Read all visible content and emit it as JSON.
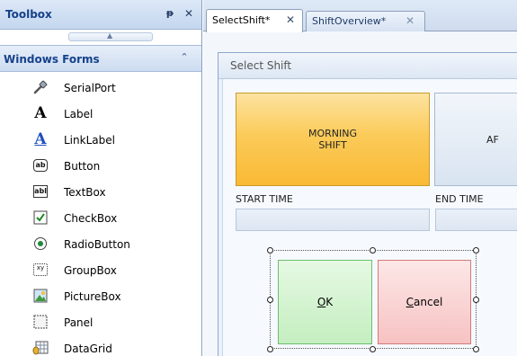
{
  "toolbox": {
    "title": "Toolbox",
    "pin_glyph": "ᵽ",
    "close_glyph": "✕",
    "category": {
      "title": "Windows Forms",
      "toggle_glyph": "≈"
    },
    "items": [
      {
        "label": "SerialPort",
        "icon": "serialport-icon"
      },
      {
        "label": "Label",
        "icon": "label-icon"
      },
      {
        "label": "LinkLabel",
        "icon": "linklabel-icon"
      },
      {
        "label": "Button",
        "icon": "button-icon"
      },
      {
        "label": "TextBox",
        "icon": "textbox-icon"
      },
      {
        "label": "CheckBox",
        "icon": "checkbox-icon"
      },
      {
        "label": "RadioButton",
        "icon": "radiobutton-icon"
      },
      {
        "label": "GroupBox",
        "icon": "groupbox-icon"
      },
      {
        "label": "PictureBox",
        "icon": "picturebox-icon"
      },
      {
        "label": "Panel",
        "icon": "panel-icon"
      },
      {
        "label": "DataGrid",
        "icon": "datagrid-icon"
      }
    ],
    "icon_text": {
      "label": "A",
      "linklabel": "A",
      "button": "ab",
      "textbox": "abl",
      "groupbox": "xy"
    }
  },
  "tabs": [
    {
      "label": "SelectShift*",
      "close": "✕",
      "active": true
    },
    {
      "label": "ShiftOverview*",
      "close": "✕",
      "active": false
    }
  ],
  "designer": {
    "title": "Select Shift",
    "morning_line1": "MORNING",
    "morning_line2": "SHIFT",
    "afternoon_partial": "AF",
    "start_time_label": "START TIME",
    "end_time_label": "END TIME",
    "ok_mnemonic": "O",
    "ok_rest": "K",
    "cancel_mnemonic": "C",
    "cancel_rest": "ancel"
  },
  "colors": {
    "accent_title": "#15428b",
    "morning_button": "#fbcb5a",
    "ok_button": "#c4eec0",
    "cancel_button": "#f7c2c2"
  }
}
